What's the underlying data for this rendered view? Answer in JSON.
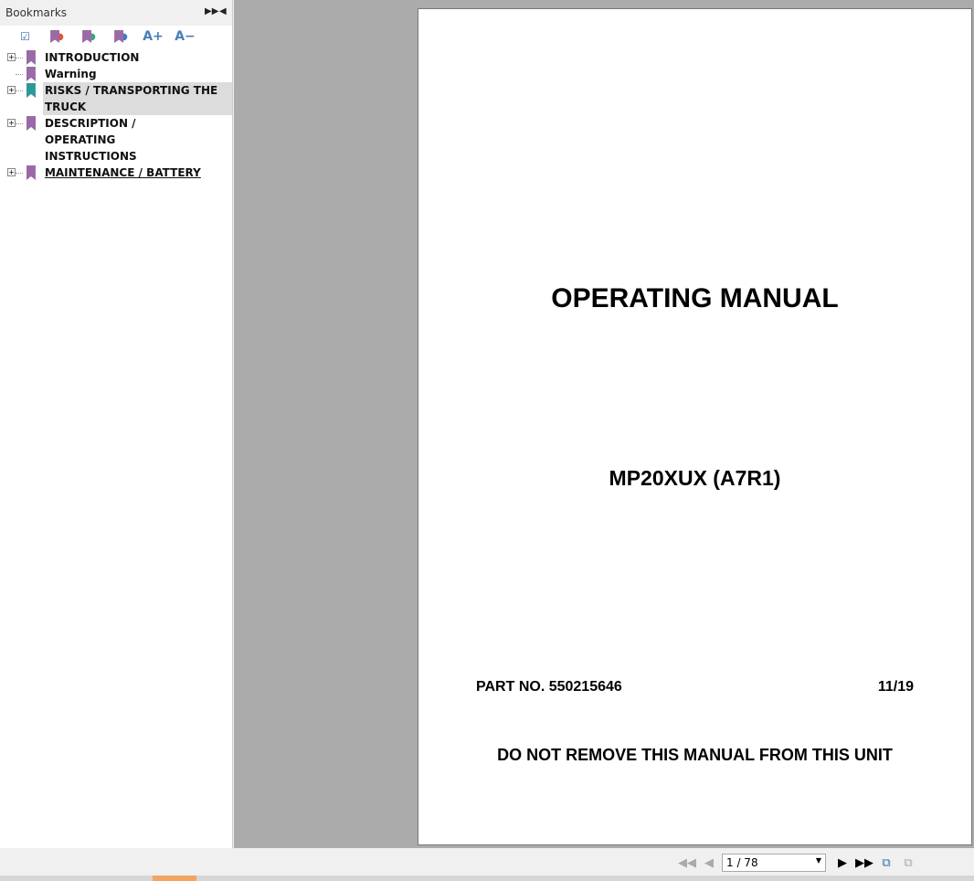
{
  "sidebar": {
    "title": "Bookmarks",
    "items": [
      {
        "label": "INTRODUCTION",
        "expandable": true
      },
      {
        "label": "Warning",
        "expandable": false
      },
      {
        "label": "RISKS / TRANSPORTING THE TRUCK",
        "expandable": true,
        "selected": true
      },
      {
        "label": "DESCRIPTION / OPERATING INSTRUCTIONS",
        "expandable": true
      },
      {
        "label": "MAINTENANCE / BATTERY",
        "expandable": true
      }
    ]
  },
  "page": {
    "title": "OPERATING MANUAL",
    "model": "MP20XUX (A7R1)",
    "part_no": "PART NO. 550215646",
    "date": "11/19",
    "notice": "DO NOT REMOVE THIS MANUAL FROM THIS UNIT"
  },
  "nav": {
    "page_indicator": "1 / 78"
  },
  "toolbar": {
    "increase_font": "A+",
    "decrease_font": "A−"
  },
  "colors": {
    "bookmark": "#9b6aa6",
    "bookmark_selected": "#2e9a98",
    "viewer_bg": "#ababab"
  }
}
